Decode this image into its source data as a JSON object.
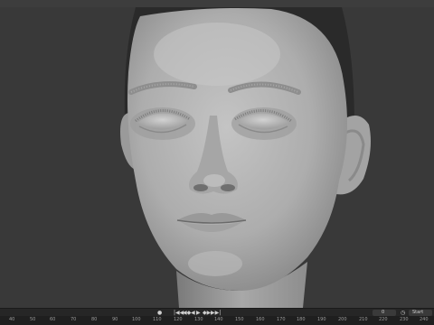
{
  "playback": {
    "keyframe_icon": "keyframe-dot-icon",
    "controls": [
      {
        "name": "jump-to-start-button",
        "icon": "jump-start-icon",
        "glyph": "|◀◀"
      },
      {
        "name": "prev-keyframe-button",
        "icon": "prev-keyframe-icon",
        "glyph": "◀◆"
      },
      {
        "name": "play-reverse-button",
        "icon": "play-reverse-icon",
        "glyph": "◀"
      },
      {
        "name": "play-button",
        "icon": "play-icon",
        "glyph": "▶"
      },
      {
        "name": "next-keyframe-button",
        "icon": "next-keyframe-icon",
        "glyph": "◆▶"
      },
      {
        "name": "jump-to-end-button",
        "icon": "jump-end-icon",
        "glyph": "▶▶|"
      }
    ],
    "current_frame": "0",
    "start_label": "Start"
  },
  "timeline": {
    "ticks": [
      "40",
      "50",
      "60",
      "70",
      "80",
      "90",
      "100",
      "110",
      "120",
      "130",
      "140",
      "150",
      "160",
      "170",
      "180",
      "190",
      "200",
      "210",
      "220",
      "230",
      "240"
    ]
  },
  "colors": {
    "viewport_bg": "#393939",
    "skin": "#b5b5b5",
    "hair_cap": "#2a2a2a"
  }
}
